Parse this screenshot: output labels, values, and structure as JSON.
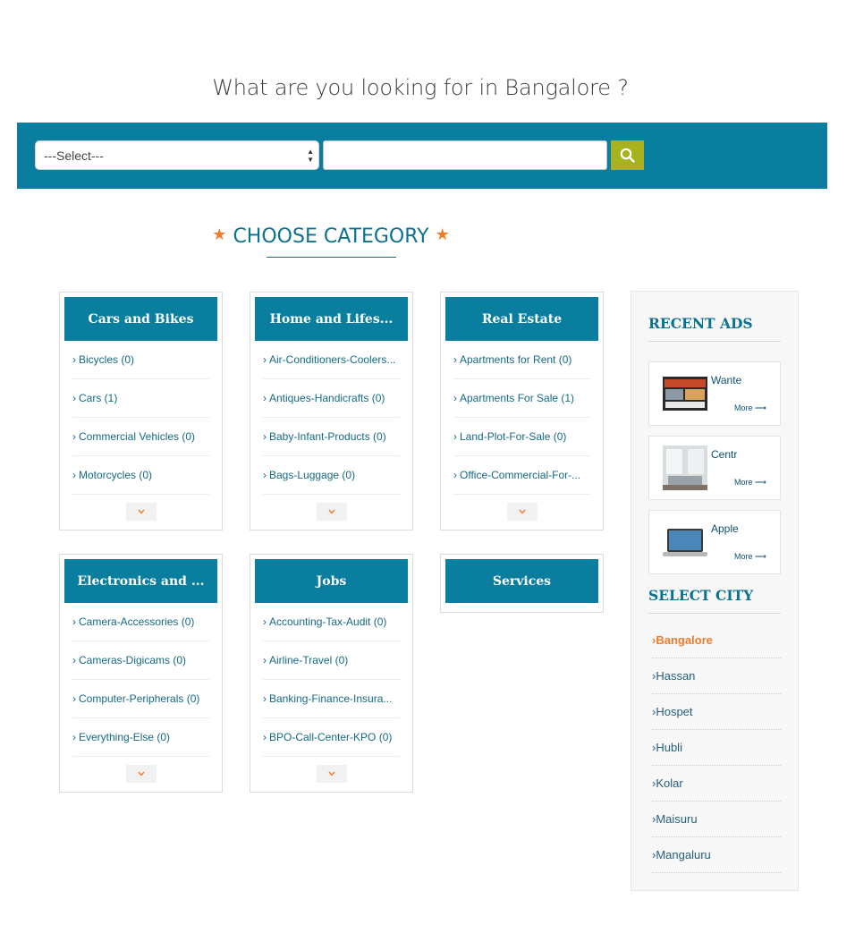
{
  "page": {
    "heading": "What are you looking for in Bangalore ?"
  },
  "search": {
    "select_value": "---Select---",
    "query_value": "",
    "button_icon": "search-icon"
  },
  "section": {
    "title": "CHOOSE CATEGORY",
    "star_icon": "★"
  },
  "categories": [
    {
      "title": "Cars and Bikes",
      "items": [
        "Bicycles (0)",
        "Cars (1)",
        "Commercial Vehicles (0)",
        "Motorcycles (0)"
      ],
      "has_more": true
    },
    {
      "title": "Home and Lifes...",
      "items": [
        "Air-Conditioners-Coolers...",
        "Antiques-Handicrafts (0)",
        "Baby-Infant-Products (0)",
        "Bags-Luggage (0)"
      ],
      "has_more": true
    },
    {
      "title": "Real Estate",
      "items": [
        "Apartments for Rent (0)",
        "Apartments For Sale (1)",
        "Land-Plot-For-Sale (0)",
        "Office-Commercial-For-..."
      ],
      "has_more": true
    },
    {
      "title": "Electronics and ...",
      "items": [
        "Camera-Accessories (0)",
        "Cameras-Digicams (0)",
        "Computer-Peripherals (0)",
        "Everything-Else (0)"
      ],
      "has_more": true
    },
    {
      "title": "Jobs",
      "items": [
        "Accounting-Tax-Audit (0)",
        "Airline-Travel (0)",
        "Banking-Finance-Insura...",
        "BPO-Call-Center-KPO (0)"
      ],
      "has_more": true
    },
    {
      "title": "Services",
      "items": [],
      "has_more": false
    }
  ],
  "sidebar": {
    "recent_ads_title": "RECENT ADS",
    "ads": [
      {
        "title": "Wante",
        "more": "More ⟶",
        "thumb": "website-screenshot-image"
      },
      {
        "title": "Centr",
        "more": "More ⟶",
        "thumb": "interior-room-image"
      },
      {
        "title": "Apple",
        "more": "More ⟶",
        "thumb": "laptop-image"
      }
    ],
    "select_city_title": "SELECT CITY",
    "cities": [
      "›Bangalore",
      "›Hassan",
      "›Hospet",
      "›Hubli",
      "›Kolar",
      "›Maisuru",
      "›Mangaluru"
    ],
    "active_city": "Bangalore"
  },
  "colors": {
    "accent": "#0a7e9e",
    "search_button": "#a7b21d",
    "highlight": "#ef7d2c"
  }
}
